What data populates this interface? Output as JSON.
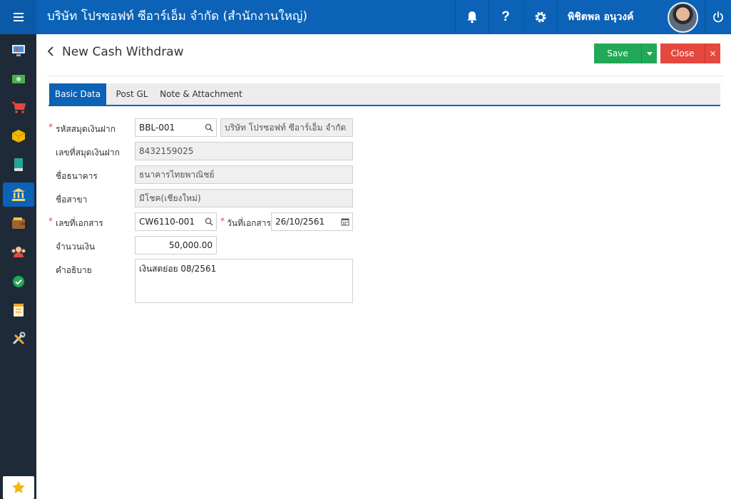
{
  "header": {
    "company_title": "บริษัท โปรซอฟท์ ซีอาร์เอ็ม จำกัด (สำนักงานใหญ่)",
    "user_name": "พิชิตพล อนุวงค์"
  },
  "page": {
    "title": "New Cash Withdraw",
    "save_label": "Save",
    "close_label": "Close"
  },
  "tabs": [
    {
      "label": "Basic Data"
    },
    {
      "label": "Post GL"
    },
    {
      "label": "Note & Attachment"
    }
  ],
  "form": {
    "account_code": {
      "label": "รหัสสมุดเงินฝาก",
      "value": "BBL-001",
      "desc": "บริษัท โปรซอฟท์ ซีอาร์เอ็ม จำกัด"
    },
    "account_no": {
      "label": "เลขที่สมุดเงินฝาก",
      "value": "8432159025"
    },
    "bank_name": {
      "label": "ชื่อธนาคาร",
      "value": "ธนาคารไทยพาณิชย์"
    },
    "branch_name": {
      "label": "ชื่อสาขา",
      "value": "มีโชค(เชียงใหม่)"
    },
    "doc_no": {
      "label": "เลขที่เอกสาร",
      "value": "CW6110-001"
    },
    "doc_date": {
      "label": "วันที่เอกสาร",
      "value": "26/10/2561"
    },
    "amount": {
      "label": "จำนวนเงิน",
      "value": "50,000.00"
    },
    "description": {
      "label": "คำอธิบาย",
      "value": "เงินสดย่อย 08/2561"
    }
  },
  "colors": {
    "topbar": "#0b62b6",
    "sidebar": "#1f2a38",
    "save": "#21a957",
    "close": "#e5483e"
  },
  "sidebar_icons": [
    "monitor-icon",
    "cash-icon",
    "cart-icon",
    "box-icon",
    "book-icon",
    "bank-icon",
    "wallet-icon",
    "user-group-icon",
    "check-circle-icon",
    "document-icon",
    "tools-icon",
    "star-icon"
  ]
}
